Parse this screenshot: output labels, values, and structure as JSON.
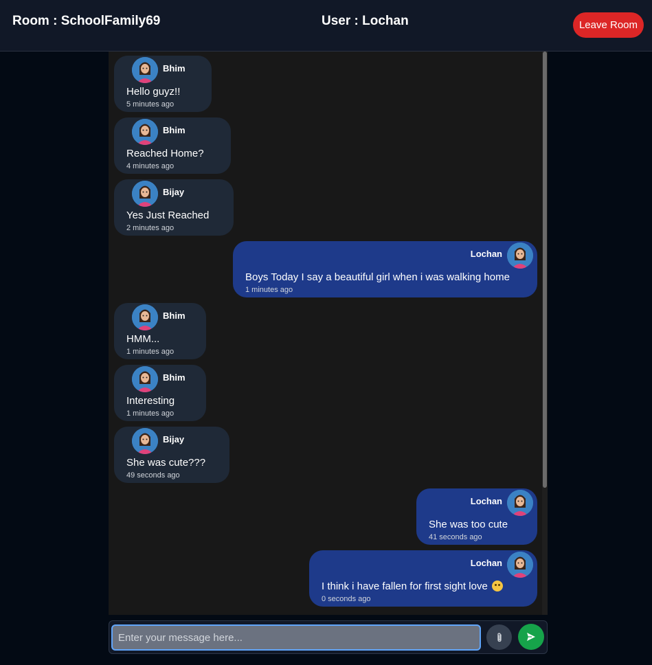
{
  "header": {
    "room_label": "Room : SchoolFamily69",
    "user_label": "User : Lochan",
    "leave_button": "Leave Room"
  },
  "messages": [
    {
      "direction": "incoming",
      "sender": "Bhim",
      "text": "Hello guyz!!",
      "time": "5 minutes ago",
      "avatar_icon": "user-avatar-icon"
    },
    {
      "direction": "incoming",
      "sender": "Bhim",
      "text": "Reached Home?",
      "time": "4 minutes ago",
      "avatar_icon": "user-avatar-icon"
    },
    {
      "direction": "incoming",
      "sender": "Bijay",
      "text": "Yes Just Reached",
      "time": "2 minutes ago",
      "avatar_icon": "user-avatar-icon"
    },
    {
      "direction": "outgoing",
      "sender": "Lochan",
      "text": "Boys Today I say a beautiful girl when i was walking home",
      "time": "1 minutes ago",
      "avatar_icon": "user-avatar-icon"
    },
    {
      "direction": "incoming",
      "sender": "Bhim",
      "text": "HMM...",
      "time": "1 minutes ago",
      "avatar_icon": "user-avatar-icon"
    },
    {
      "direction": "incoming",
      "sender": "Bhim",
      "text": "Interesting",
      "time": "1 minutes ago",
      "avatar_icon": "user-avatar-icon"
    },
    {
      "direction": "incoming",
      "sender": "Bijay",
      "text": "She was cute???",
      "time": "49 seconds ago",
      "avatar_icon": "user-avatar-icon"
    },
    {
      "direction": "outgoing",
      "sender": "Lochan",
      "text": "She was too cute",
      "time": "41 seconds ago",
      "avatar_icon": "user-avatar-icon"
    },
    {
      "direction": "outgoing",
      "sender": "Lochan",
      "text": "I think i have fallen for first sight love",
      "time": "0 seconds ago",
      "avatar_icon": "user-avatar-icon",
      "emoji": "smiling-face-emoji"
    }
  ],
  "composer": {
    "value": "",
    "placeholder": "Enter your message here...",
    "attach_icon": "paperclip-icon",
    "send_icon": "send-icon"
  },
  "colors": {
    "header_bg": "#111827",
    "page_bg": "#030a14",
    "chat_bg": "#181818",
    "incoming_bubble": "#1f2937",
    "outgoing_bubble": "#1e3a8a",
    "leave_button": "#dc2626",
    "send_button": "#16a34a",
    "input_border": "#60a5fa"
  }
}
